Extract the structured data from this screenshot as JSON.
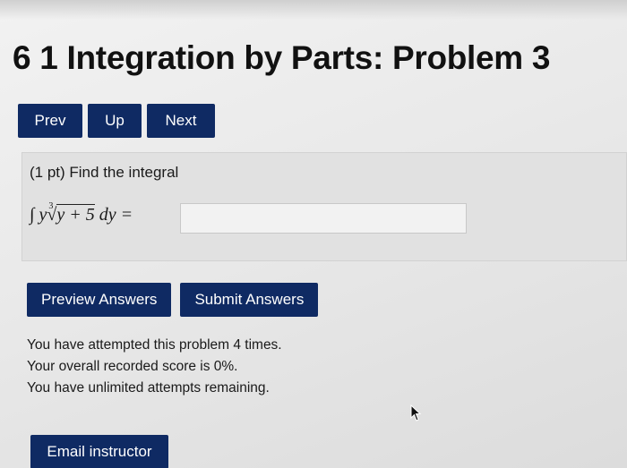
{
  "page": {
    "title": "6 1 Integration by Parts: Problem 3"
  },
  "nav": {
    "prev_label": "Prev",
    "up_label": "Up",
    "next_label": "Next"
  },
  "problem": {
    "points": "(1 pt) Find the integral",
    "integral_sign": "∫",
    "integrand_var": "y",
    "root_index": "3",
    "radicand": "y + 5",
    "differential": "dy",
    "equals": "=",
    "answer_value": ""
  },
  "actions": {
    "preview_label": "Preview Answers",
    "submit_label": "Submit Answers"
  },
  "status": {
    "attempts": "You have attempted this problem 4 times.",
    "score": "Your overall recorded score is 0%.",
    "remaining": "You have unlimited attempts remaining."
  },
  "footer": {
    "email_label": "Email instructor"
  },
  "colors": {
    "button_bg": "#0f2a63",
    "button_text": "#ffffff",
    "problem_bg": "#e1e1e1"
  }
}
